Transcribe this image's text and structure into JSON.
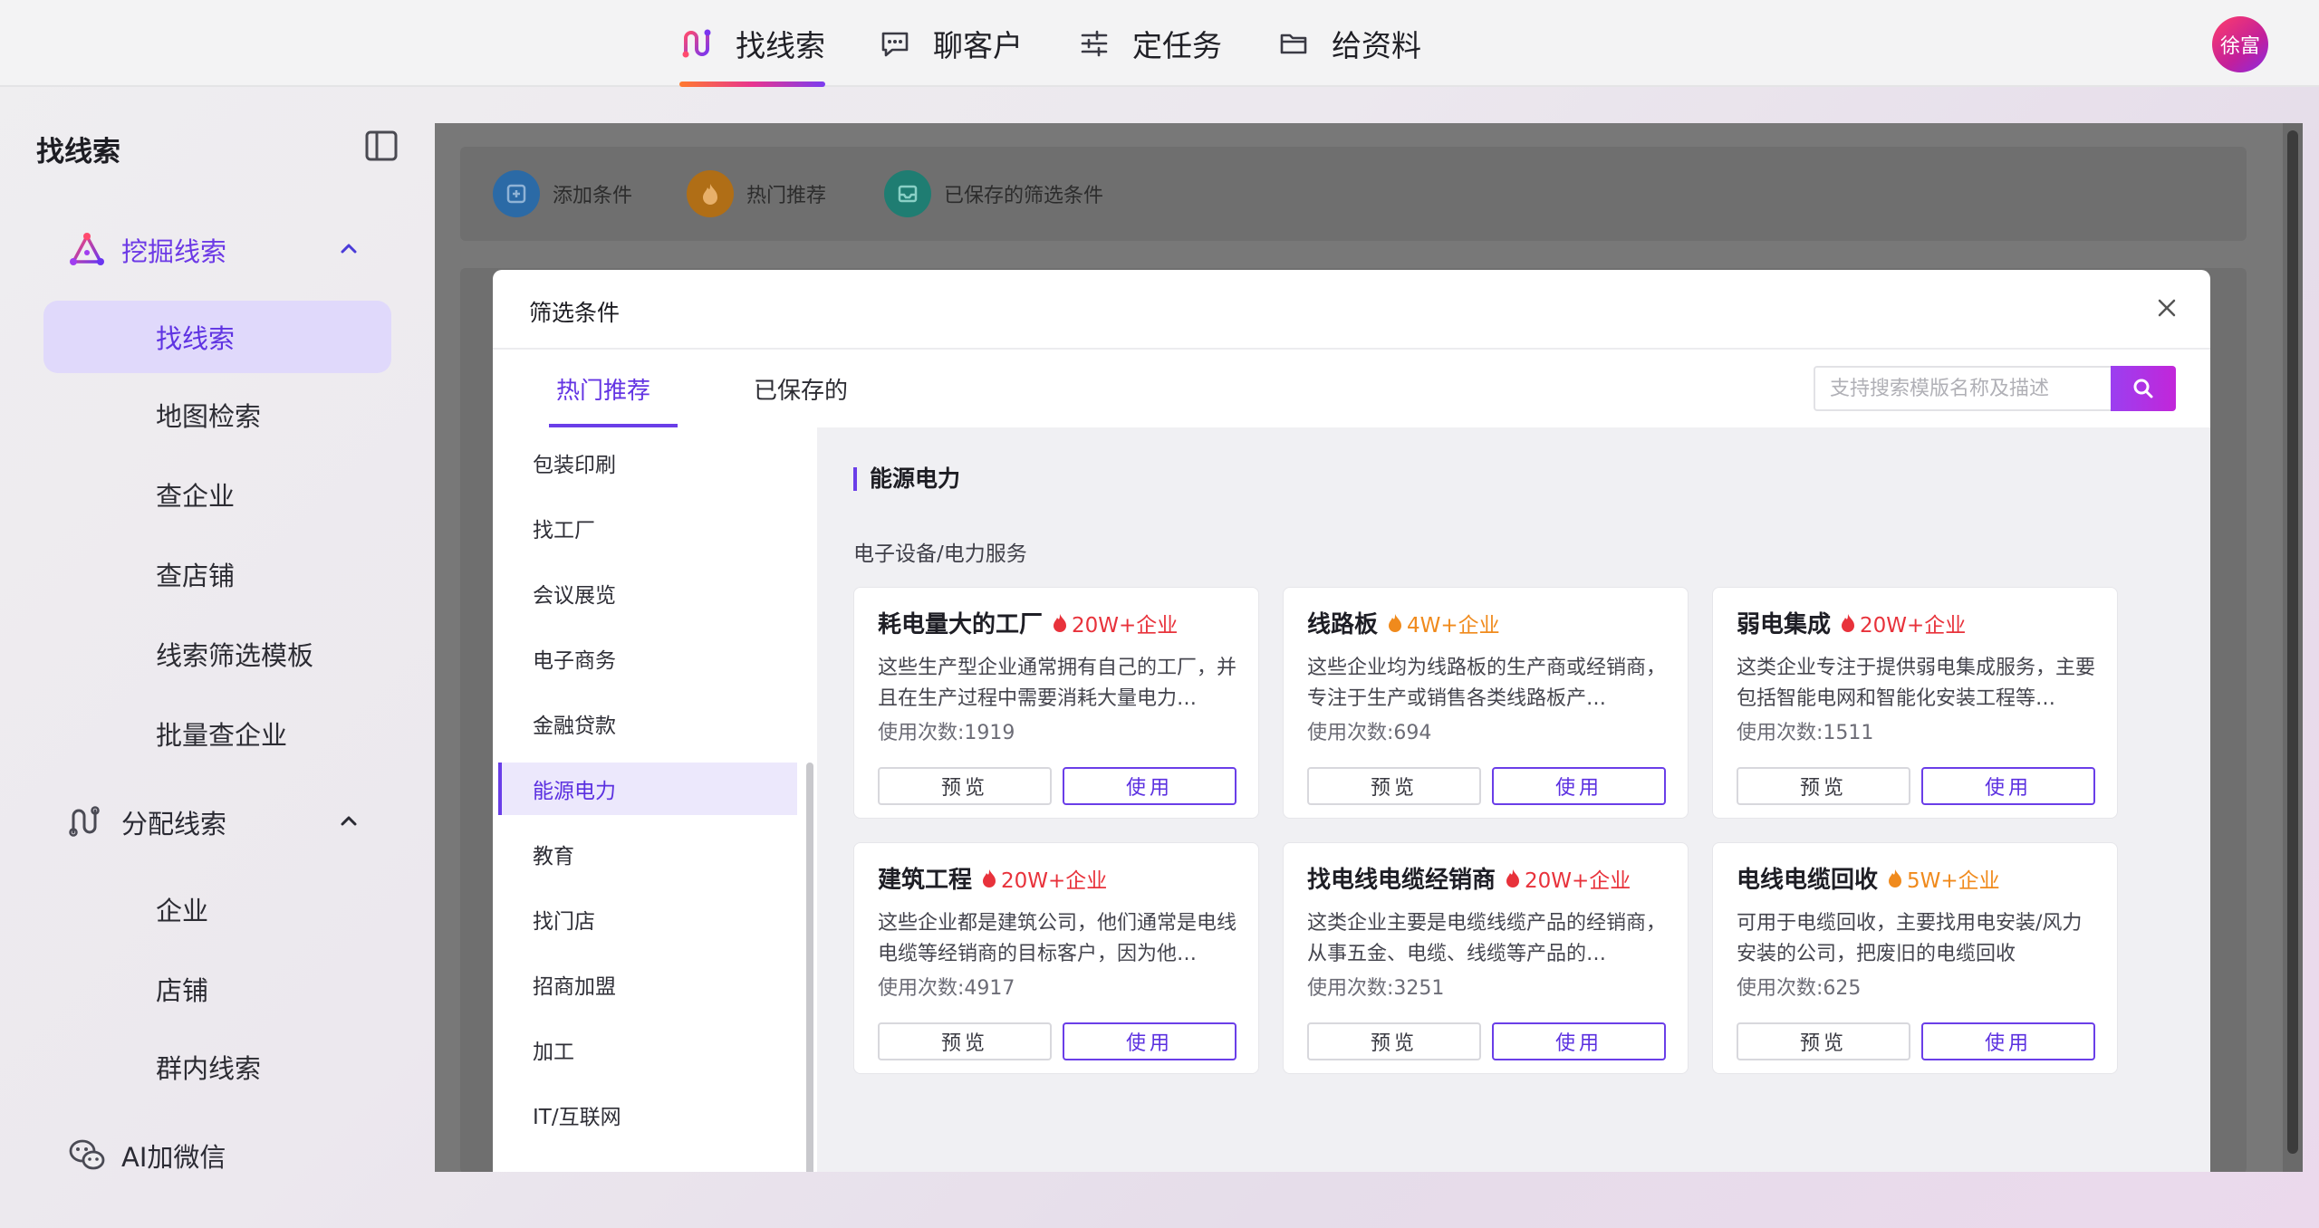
{
  "topnav": {
    "items": [
      {
        "label": "找线索",
        "icon": "trace-icon",
        "active": true
      },
      {
        "label": "聊客户",
        "icon": "chat-icon",
        "active": false
      },
      {
        "label": "定任务",
        "icon": "sliders-icon",
        "active": false
      },
      {
        "label": "给资料",
        "icon": "folder-icon",
        "active": false
      }
    ],
    "avatar": "徐富"
  },
  "sidebar": {
    "title": "找线索",
    "groups": [
      {
        "label": "挖掘线索",
        "icon": "mine-icon",
        "open": true,
        "items": [
          "找线索",
          "地图检索",
          "查企业",
          "查店铺",
          "线索筛选模板",
          "批量查企业"
        ]
      },
      {
        "label": "分配线索",
        "icon": "distribute-icon",
        "open": false,
        "items": [
          "企业",
          "店铺",
          "群内线索"
        ]
      },
      {
        "label": "AI加微信",
        "icon": "wechat-icon"
      }
    ],
    "active_item": "找线索"
  },
  "toolbar": {
    "add": "添加条件",
    "hot": "热门推荐",
    "saved": "已保存的筛选条件"
  },
  "modal": {
    "title": "筛选条件",
    "tabs": [
      "热门推荐",
      "已保存的"
    ],
    "active_tab": "热门推荐",
    "search_placeholder": "支持搜索模版名称及描述",
    "categories": [
      "包装印刷",
      "找工厂",
      "会议展览",
      "电子商务",
      "金融贷款",
      "能源电力",
      "教育",
      "找门店",
      "招商加盟",
      "加工",
      "IT/互联网"
    ],
    "active_category": "能源电力",
    "section_title": "能源电力",
    "subsection": "电子设备/电力服务",
    "preview_label": "预览",
    "use_label": "使用",
    "cards": [
      {
        "name": "耗电量大的工厂",
        "tag": "20W+企业",
        "tag_color": "#e8323b",
        "desc": "这些生产型企业通常拥有自己的工厂，并且在生产过程中需要消耗大量电力…",
        "usage": "使用次数:1919"
      },
      {
        "name": "线路板",
        "tag": "4W+企业",
        "tag_color": "#f08a1c",
        "desc": "这些企业均为线路板的生产商或经销商，专注于生产或销售各类线路板产…",
        "usage": "使用次数:694"
      },
      {
        "name": "弱电集成",
        "tag": "20W+企业",
        "tag_color": "#e8323b",
        "desc": "这类企业专注于提供弱电集成服务，主要包括智能电网和智能化安装工程等…",
        "usage": "使用次数:1511"
      },
      {
        "name": "建筑工程",
        "tag": "20W+企业",
        "tag_color": "#e8323b",
        "desc": "这些企业都是建筑公司，他们通常是电线电缆等经销商的目标客户，因为他…",
        "usage": "使用次数:4917"
      },
      {
        "name": "找电线电缆经销商",
        "tag": "20W+企业",
        "tag_color": "#e8323b",
        "desc": "这类企业主要是电缆线缆产品的经销商，从事五金、电缆、线缆等产品的…",
        "usage": "使用次数:3251"
      },
      {
        "name": "电线电缆回收",
        "tag": "5W+企业",
        "tag_color": "#f08a1c",
        "desc": "可用于电缆回收，主要找用电安装/风力安装的公司，把废旧的电缆回收",
        "usage": "使用次数:625"
      }
    ]
  },
  "colors": {
    "accent": "#6a3ee8",
    "hot_red": "#e8323b",
    "hot_orange": "#f08a1c"
  }
}
